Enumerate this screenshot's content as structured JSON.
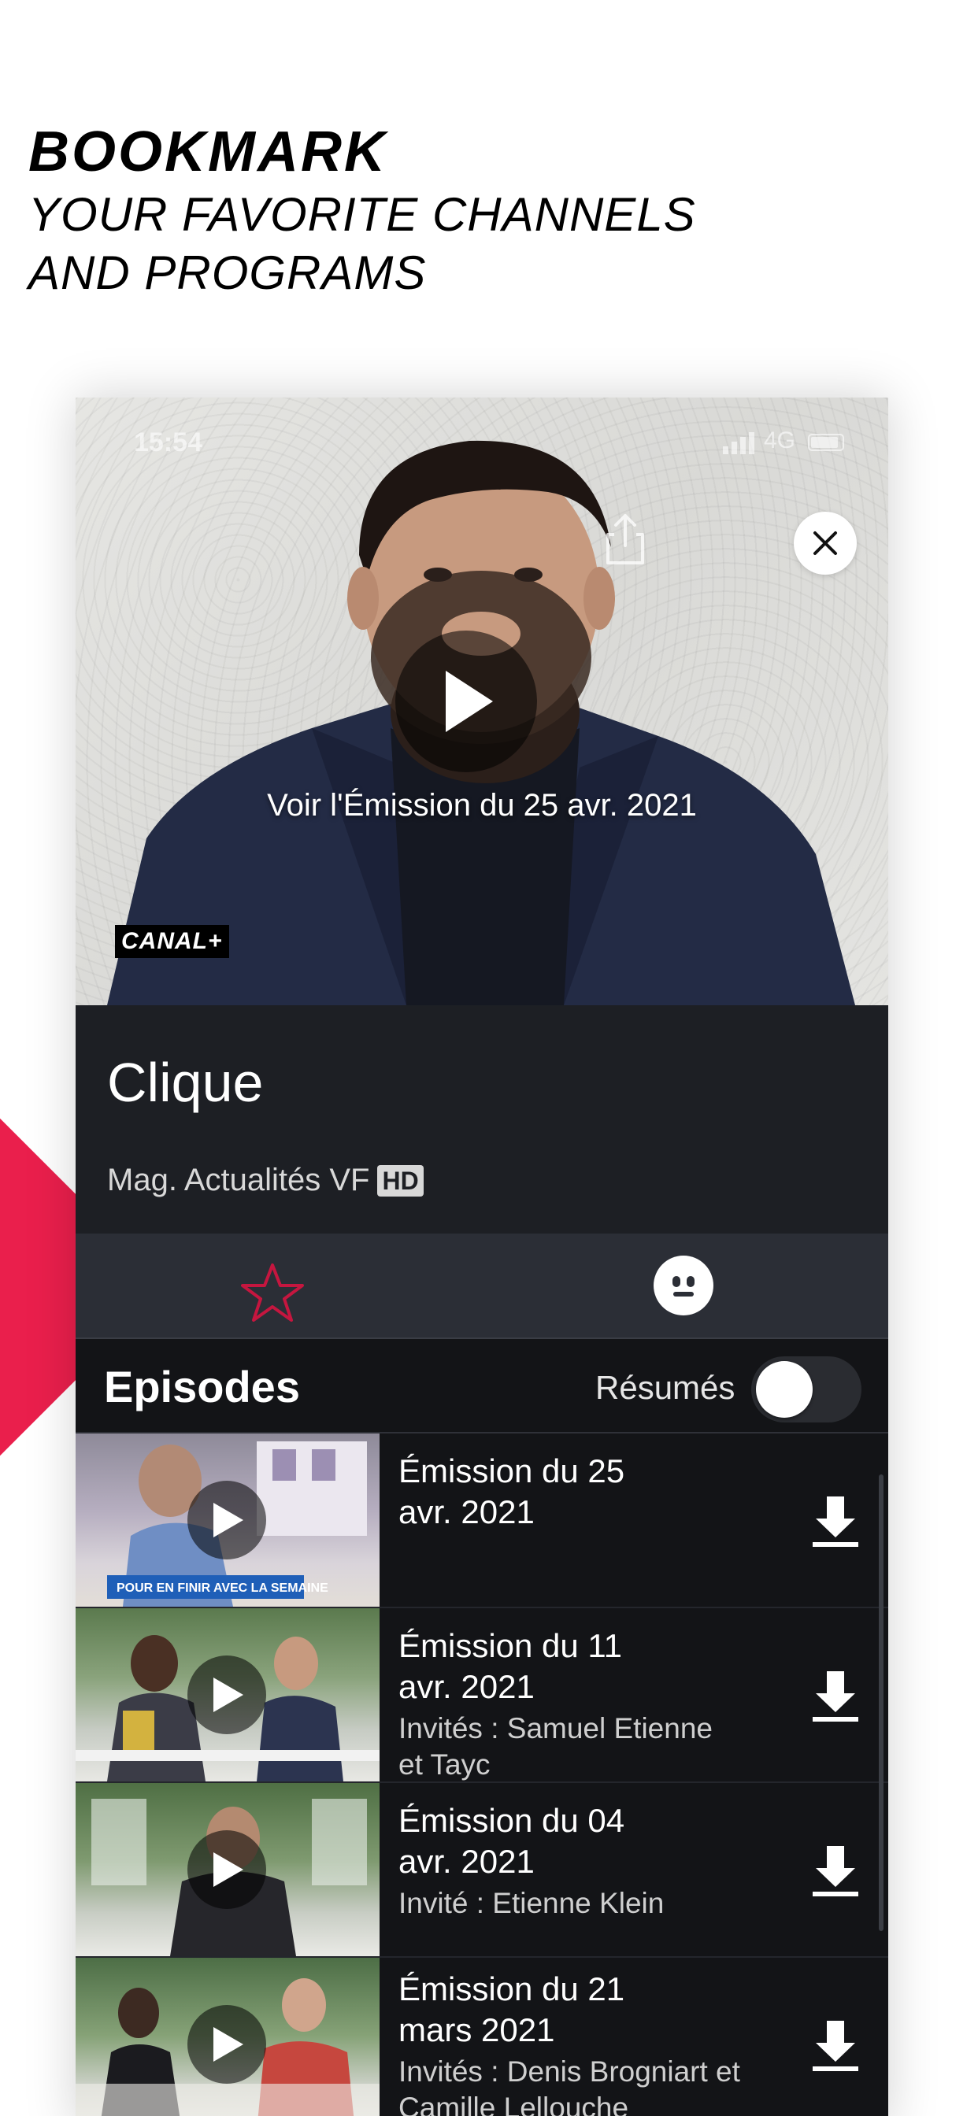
{
  "promo": {
    "headline": "BOOKMARK",
    "line1": "YOUR FAVORITE CHANNELS",
    "line2": "AND PROGRAMS"
  },
  "status_bar": {
    "time": "15:54",
    "network": "4G"
  },
  "hero": {
    "caption": "Voir l'Émission du 25 avr. 2021",
    "channel_logo": "CANAL+"
  },
  "program": {
    "title": "Clique",
    "meta": "Mag. Actualités VF",
    "badge": "HD"
  },
  "episodes_section": {
    "title": "Episodes",
    "toggle_label": "Résumés",
    "toggle_on": false
  },
  "episodes": [
    {
      "title": "Émission du 25 avr. 2021",
      "title_line1": "Émission du 25",
      "title_line2": "avr. 2021",
      "sub_line1": "",
      "sub_line2": ""
    },
    {
      "title": "Émission du 11 avr. 2021",
      "title_line1": "Émission du 11",
      "title_line2": "avr. 2021",
      "sub_line1": "Invités : Samuel Etienne",
      "sub_line2": "et Tayc"
    },
    {
      "title": "Émission du 04 avr. 2021",
      "title_line1": "Émission du 04",
      "title_line2": "avr. 2021",
      "sub_line1": "Invité : Etienne Klein",
      "sub_line2": ""
    },
    {
      "title": "Émission du 21 mars 2021",
      "title_line1": "Émission du 21",
      "title_line2": "mars 2021",
      "sub_line1": "Invités : Denis Brogniart et",
      "sub_line2": "Camille Lellouche"
    }
  ],
  "thumb_banner": "POUR EN FINIR AVEC LA SEMAINE",
  "colors": {
    "accent": "#ea1f4c",
    "panel": "#1d1f24",
    "list_bg": "#131417",
    "star": "#c5163f"
  },
  "icons": [
    "share-icon",
    "close-icon",
    "play-icon",
    "star-icon",
    "smiley-icon",
    "download-icon"
  ]
}
